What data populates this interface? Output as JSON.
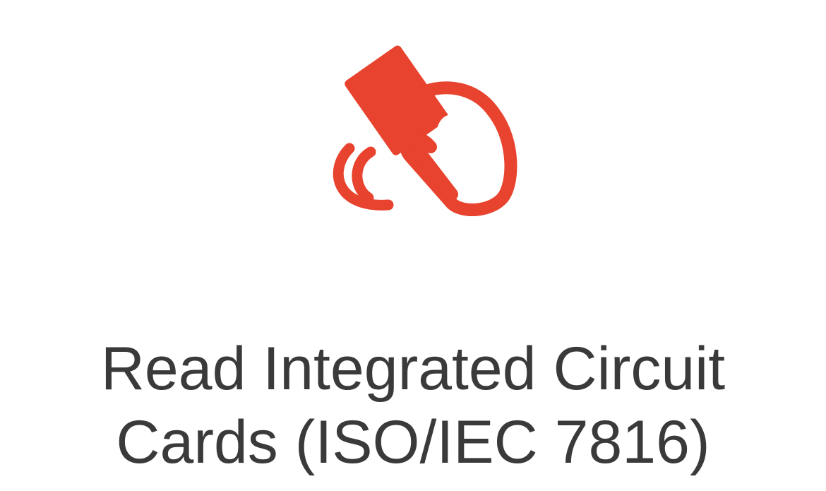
{
  "feature": {
    "icon": "contactless-card-tap-icon",
    "accent_color": "#e8432e",
    "title_line_1": "Read Integrated Circuit",
    "title_line_2": "Cards (ISO/IEC 7816)"
  }
}
